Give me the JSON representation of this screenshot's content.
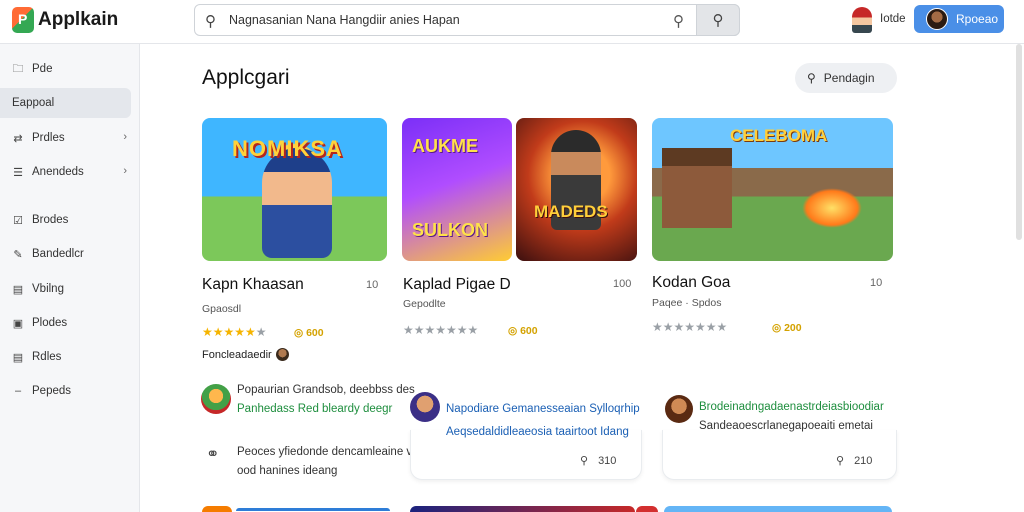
{
  "app": {
    "name": "Applkain"
  },
  "search": {
    "value": "Nagnasanian Nana Hangdiir anies Hapan"
  },
  "header": {
    "user_label": "Iotde",
    "profile_label": "Rpoeao"
  },
  "sidebar": {
    "items": [
      {
        "label": "Pde",
        "icon": "folder-icon"
      },
      {
        "label": "Eappoal",
        "icon": "",
        "active": true
      },
      {
        "label": "Prdles",
        "icon": "swap-icon",
        "chevron": true
      },
      {
        "label": "Anendeds",
        "icon": "list-icon",
        "chevron": true
      },
      {
        "label": "Brodes",
        "icon": "shield-icon"
      },
      {
        "label": "Bandedlcr",
        "icon": "edit-icon"
      },
      {
        "label": "Vbilng",
        "icon": "laptop-icon"
      },
      {
        "label": "Plodes",
        "icon": "tablet-icon"
      },
      {
        "label": "Rdles",
        "icon": "document-icon"
      },
      {
        "label": "Pepeds",
        "icon": "dash-icon"
      }
    ]
  },
  "main": {
    "title": "Applcgari",
    "action_label": "Pendagin"
  },
  "games": [
    {
      "title": "Kapn Khaasan",
      "num": "10",
      "subtitle": "Gpaosdl",
      "stars_full": 5,
      "stars_gray": 0,
      "coin_text": "◎ 600",
      "developer": "Foncleadaedir",
      "art_text": "NOMIKSA"
    },
    {
      "title": "Kaplad Pigae D",
      "num": "100",
      "subtitle": "Gepodlte",
      "stars_full": 0,
      "stars_gray": 7,
      "coin_text": "◎ 600",
      "art_text_1": "AUKME",
      "art_text_2": "SULKON",
      "art_text_3": "MADEDS"
    },
    {
      "title": "Kodan Goa",
      "num": "10",
      "subtitle": "Paqee · Spdos",
      "stars_full": 0,
      "stars_gray": 7,
      "coin_text": "◎ 200",
      "art_text": "CELEBOMA"
    }
  ],
  "reviews": [
    {
      "line1": "Popaurian Grandsob, deebbss des",
      "line2": "Panhedass Red bleardy deegr",
      "line3": "Peoces yfiedonde dencamleaine ves",
      "line4": "ood hanines ideang"
    },
    {
      "line1": "Napodiare Gemanesseaian Sylloqrhip",
      "line2": "Aeqsedaldidleaeosia taairtoot Idang",
      "meta_value": "310"
    },
    {
      "line1": "Brodeinadngadaenastrdeiasbioodiar",
      "line2": "Sandeaoescrlanegapoeaiti emetai",
      "meta_value": "210"
    }
  ],
  "colors": {
    "accent": "#4a8fe7",
    "star": "#f5b400",
    "review_green": "#1e8e3e",
    "review_blue": "#1a5fb4"
  }
}
